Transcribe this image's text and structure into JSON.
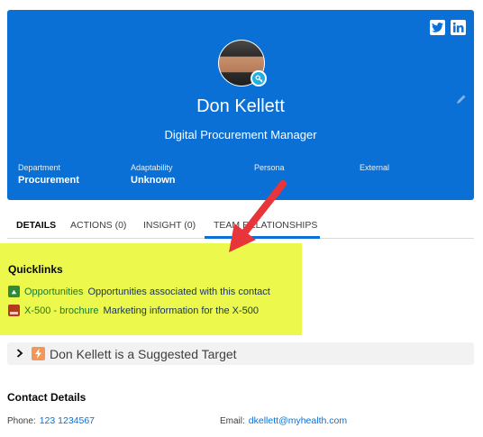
{
  "header": {
    "name": "Don Kellett",
    "title": "Digital Procurement Manager",
    "background_color": "#0a70d6",
    "social": [
      "twitter-icon",
      "linkedin-icon"
    ],
    "fields": [
      {
        "label": "Department",
        "value": "Procurement"
      },
      {
        "label": "Adaptability",
        "value": "Unknown"
      },
      {
        "label": "Persona",
        "value": ""
      },
      {
        "label": "External",
        "value": ""
      }
    ]
  },
  "tabs": [
    {
      "label": "DETAILS",
      "active": true
    },
    {
      "label": "ACTIONS (0)",
      "active": false
    },
    {
      "label": "INSIGHT (0)",
      "active": false
    },
    {
      "label": "TEAM RELATIONSHIPS",
      "active": false
    }
  ],
  "quicklinks": {
    "title": "Quicklinks",
    "highlight_color": "#ecf94c",
    "items": [
      {
        "link": "Opportunities",
        "description": "Opportunities associated with this contact",
        "icon": "opportunity-icon"
      },
      {
        "link": "X-500 - brochure",
        "description": "Marketing information for the X-500",
        "icon": "pdf-icon"
      }
    ]
  },
  "suggestion": {
    "text": "Don Kellett is a Suggested Target",
    "icon": "lightning-icon"
  },
  "contact_details": {
    "title": "Contact Details",
    "phone_label": "Phone:",
    "phone": "123 1234567",
    "email_label": "Email:",
    "email": "dkellett@myhealth.com"
  },
  "annotation": {
    "color": "#e8353a",
    "type": "red-arrow"
  }
}
